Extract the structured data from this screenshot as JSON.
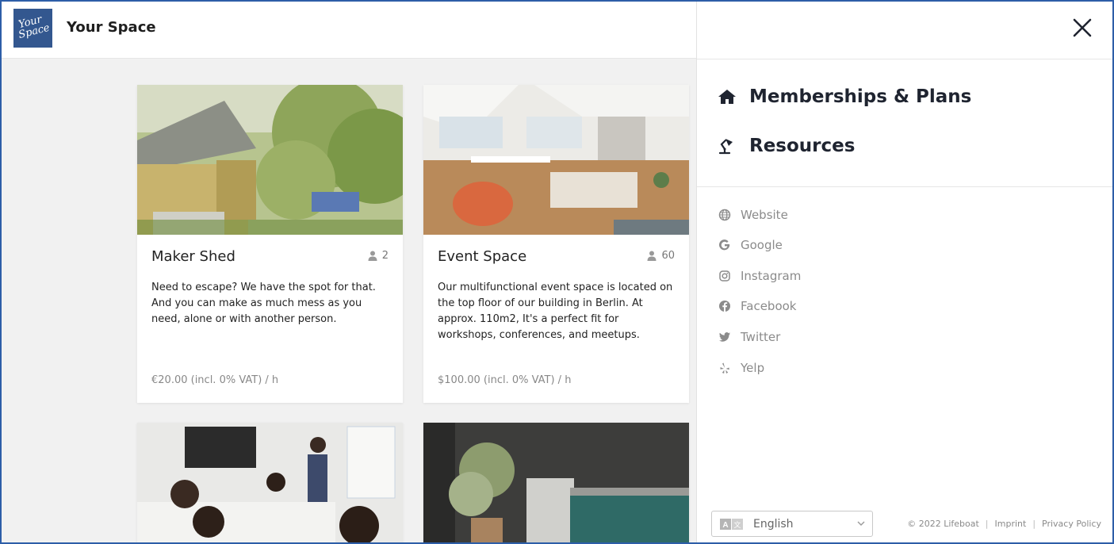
{
  "header": {
    "logo_text_1": "Your",
    "logo_text_2": "Space",
    "app_name": "Your Space"
  },
  "cards": [
    {
      "title": "Maker Shed",
      "capacity": "2",
      "description": "Need to escape? We have the spot for that. And you can make as much mess as you need, alone or with another person.",
      "price": "€20.00 (incl. 0% VAT) / h"
    },
    {
      "title": "Event Space",
      "capacity": "60",
      "description": "Our multifunctional event space is located on the top floor of our building in Berlin. At approx. 110m2, It's a perfect fit for workshops, conferences, and meetups.",
      "price": "$100.00 (incl. 0% VAT) / h"
    }
  ],
  "drawer": {
    "nav": [
      {
        "label": "Memberships & Plans",
        "icon": "home-icon"
      },
      {
        "label": "Resources",
        "icon": "desk-lamp-icon"
      }
    ],
    "links": [
      {
        "label": "Website",
        "icon": "globe-icon"
      },
      {
        "label": "Google",
        "icon": "google-icon"
      },
      {
        "label": "Instagram",
        "icon": "instagram-icon"
      },
      {
        "label": "Facebook",
        "icon": "facebook-icon"
      },
      {
        "label": "Twitter",
        "icon": "twitter-icon"
      },
      {
        "label": "Yelp",
        "icon": "yelp-icon"
      }
    ],
    "language": "English",
    "footer": {
      "copyright": "© 2022 Lifeboat",
      "imprint": "Imprint",
      "privacy": "Privacy Policy"
    }
  },
  "colors": {
    "brand": "#33578f",
    "frame": "#2d5ea8",
    "text_dark": "#1f2430",
    "muted": "#8b8b8b"
  }
}
